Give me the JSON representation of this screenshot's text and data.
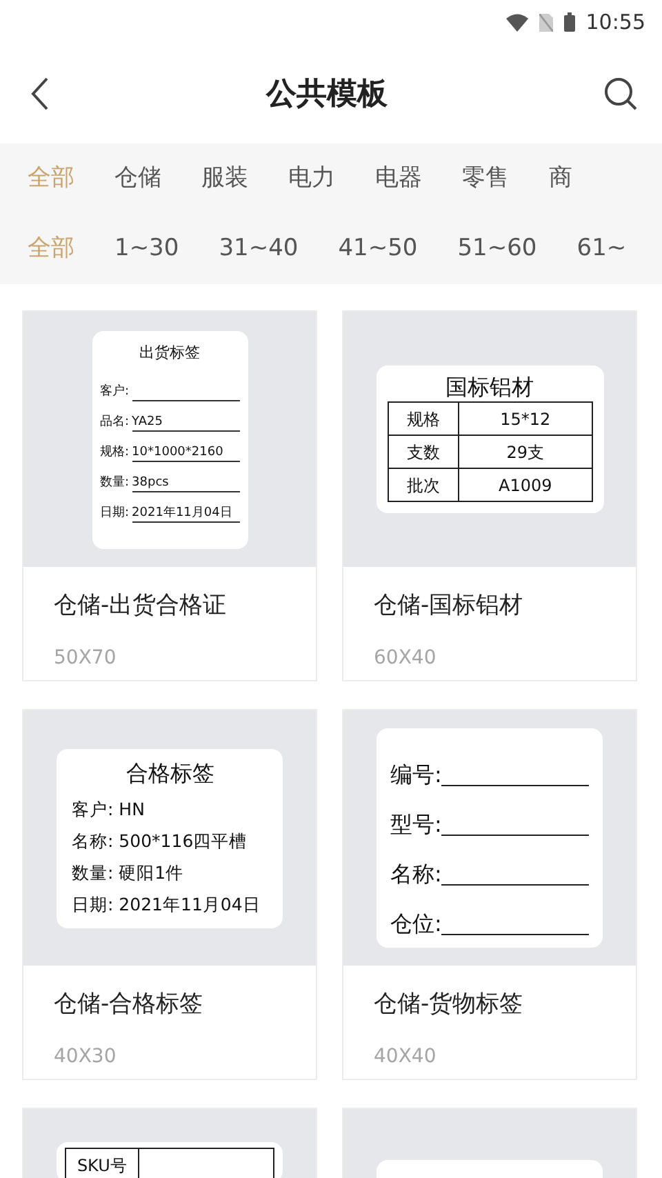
{
  "status_bar": {
    "time": "10:55"
  },
  "header": {
    "title": "公共模板"
  },
  "category_tabs": [
    {
      "label": "全部",
      "selected": true
    },
    {
      "label": "仓储",
      "selected": false
    },
    {
      "label": "服装",
      "selected": false
    },
    {
      "label": "电力",
      "selected": false
    },
    {
      "label": "电器",
      "selected": false
    },
    {
      "label": "零售",
      "selected": false
    },
    {
      "label": "商",
      "selected": false
    }
  ],
  "size_tabs": [
    {
      "label": "全部",
      "selected": true
    },
    {
      "label": "1~30",
      "selected": false
    },
    {
      "label": "31~40",
      "selected": false
    },
    {
      "label": "41~50",
      "selected": false
    },
    {
      "label": "51~60",
      "selected": false
    },
    {
      "label": "61~",
      "selected": false
    }
  ],
  "templates": [
    {
      "title": "仓储-出货合格证",
      "size": "50X70",
      "preview": {
        "kind": "compact_form",
        "heading": "出货标签",
        "fields": [
          {
            "label": "客户:"
          },
          {
            "label": "品名:",
            "value": "YA25"
          },
          {
            "label": "规格:",
            "value": "10*1000*2160"
          },
          {
            "label": "数量:",
            "value": "38pcs"
          },
          {
            "label": "日期:",
            "value": "2021年11月04日"
          }
        ]
      }
    },
    {
      "title": "仓储-国标铝材",
      "size": "60X40",
      "preview": {
        "kind": "table",
        "heading": "国标铝材",
        "rows": [
          {
            "label": "规格",
            "value": "15*12"
          },
          {
            "label": "支数",
            "value": "29支"
          },
          {
            "label": "批次",
            "value": "A1009"
          }
        ]
      }
    },
    {
      "title": "仓储-合格标签",
      "size": "40X30",
      "preview": {
        "kind": "plain_form",
        "heading": "合格标签",
        "fields": [
          {
            "label": "客户:",
            "value": "HN"
          },
          {
            "label": "名称:",
            "value": "500*116四平槽"
          },
          {
            "label": "数量:",
            "value": "硬阳1件"
          },
          {
            "label": "日期:",
            "value": "2021年11月04日"
          }
        ]
      }
    },
    {
      "title": "仓储-货物标签",
      "size": "40X40",
      "preview": {
        "kind": "blank_form",
        "fields": [
          {
            "label": "编号:"
          },
          {
            "label": "型号:"
          },
          {
            "label": "名称:"
          },
          {
            "label": "仓位:"
          }
        ]
      }
    },
    {
      "preview": {
        "kind": "table",
        "rows": [
          {
            "label": "SKU号"
          }
        ]
      }
    },
    {
      "preview": {
        "kind": "blank"
      }
    }
  ]
}
